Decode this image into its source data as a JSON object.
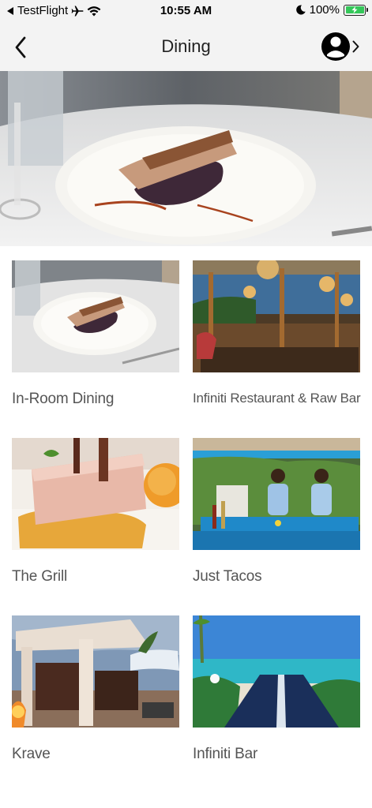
{
  "status": {
    "carrier": "TestFlight",
    "time": "10:55 AM",
    "battery": "100%"
  },
  "nav": {
    "title": "Dining"
  },
  "restaurants": [
    {
      "name": "In-Room Dining"
    },
    {
      "name": "Infiniti Restaurant & Raw Bar"
    },
    {
      "name": "The Grill"
    },
    {
      "name": "Just Tacos"
    },
    {
      "name": "Krave"
    },
    {
      "name": "Infiniti Bar"
    }
  ],
  "colors": {
    "bar_background": "#f3f3f3",
    "battery_green": "#34c759",
    "label_gray": "#555555"
  },
  "icons": {
    "back": "chevron-left-icon",
    "profile": "user-circle-icon",
    "profile_chevron": "chevron-right-icon",
    "airplane": "airplane-icon",
    "wifi": "wifi-icon",
    "moon": "moon-icon",
    "battery": "battery-charging-icon"
  }
}
